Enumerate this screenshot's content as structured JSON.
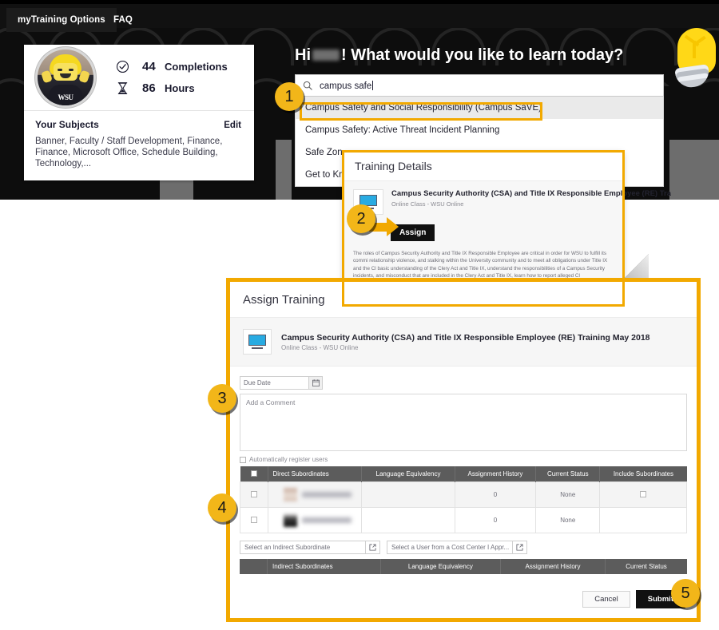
{
  "nav": {
    "tabs": [
      {
        "label": "myTraining Options",
        "active": true
      },
      {
        "label": "FAQ",
        "active": false
      }
    ]
  },
  "profile": {
    "avatar_label": "WSU",
    "stats": [
      {
        "icon": "check-circle-icon",
        "value": "44",
        "label": "Completions"
      },
      {
        "icon": "hourglass-icon",
        "value": "86",
        "label": "Hours"
      }
    ],
    "subjects_title": "Your Subjects",
    "edit_label": "Edit",
    "subjects_list": "Banner, Faculty / Staff Development, Finance, Finance, Microsoft Office, Schedule Building, Technology,..."
  },
  "hero": {
    "greeting_prefix": "Hi",
    "greeting_suffix": "! What would you like to learn today?"
  },
  "search": {
    "icon": "search-icon",
    "value": "campus safe",
    "results": [
      {
        "label": "Campus Safety and Social Responsibility (Campus SaVE)",
        "selected": true
      },
      {
        "label": "Campus Safety: Active Threat Incident Planning",
        "selected": false
      },
      {
        "label": "Safe Zon",
        "selected": false
      },
      {
        "label": "Get to Kn",
        "selected": false
      }
    ]
  },
  "training_details": {
    "title": "Training Details",
    "course_icon": "monitor-icon",
    "course_title": "Campus Security Authority (CSA) and Title IX Responsible Employee (RE) Tra",
    "course_sub": "Online Class  -  WSU Online",
    "assign_label": "Assign",
    "description": "The roles of Campus Security Authority and Title IX Responsible Employee are critical in order for WSU to fulfill its commi relationship violence, and stalking within the University community and to meet all obligations under Title IX and the Cl basic understanding of the Clery Act and Title IX, understand the responsibilities of a Campus Security incidents, and misconduct that are included in the Clery Act and Title IX, learn how to report alleged Cl"
  },
  "assign_training": {
    "title": "Assign Training",
    "course_icon": "monitor-icon",
    "course_title": "Campus Security Authority (CSA) and Title IX Responsible Employee (RE) Training May 2018",
    "course_sub": "Online Class  -  WSU Online",
    "due_date_placeholder": "Due Date",
    "calendar_icon": "calendar-icon",
    "comment_placeholder": "Add a Comment",
    "auto_register_label": "Automatically register users",
    "direct_table": {
      "headers": [
        "",
        "Direct Subordinates",
        "Language Equivalency",
        "Assignment History",
        "Current Status",
        "Include Subordinates"
      ],
      "rows": [
        {
          "name": "",
          "language": "",
          "history": "0",
          "status": "None",
          "include": true
        },
        {
          "name": "",
          "language": "",
          "history": "0",
          "status": "None",
          "include": false
        }
      ]
    },
    "indirect_picker_placeholder": "Select an Indirect Subordinate",
    "costcenter_picker_placeholder": "Select a User from a Cost Center I Appr...",
    "popout_icon": "external-link-icon",
    "indirect_table": {
      "headers": [
        "",
        "Indirect Subordinates",
        "Language Equivalency",
        "Assignment History",
        "Current Status"
      ]
    },
    "cancel_label": "Cancel",
    "submit_label": "Submit"
  },
  "callouts": [
    {
      "number": "1"
    },
    {
      "number": "2"
    },
    {
      "number": "3"
    },
    {
      "number": "4"
    },
    {
      "number": "5"
    }
  ],
  "colors": {
    "accent_orange": "#f2a900",
    "badge_gold": "#f2b619",
    "shell_black": "#0d0d0d",
    "header_gray": "#5c5c5c",
    "monitor_blue": "#29abe2"
  }
}
